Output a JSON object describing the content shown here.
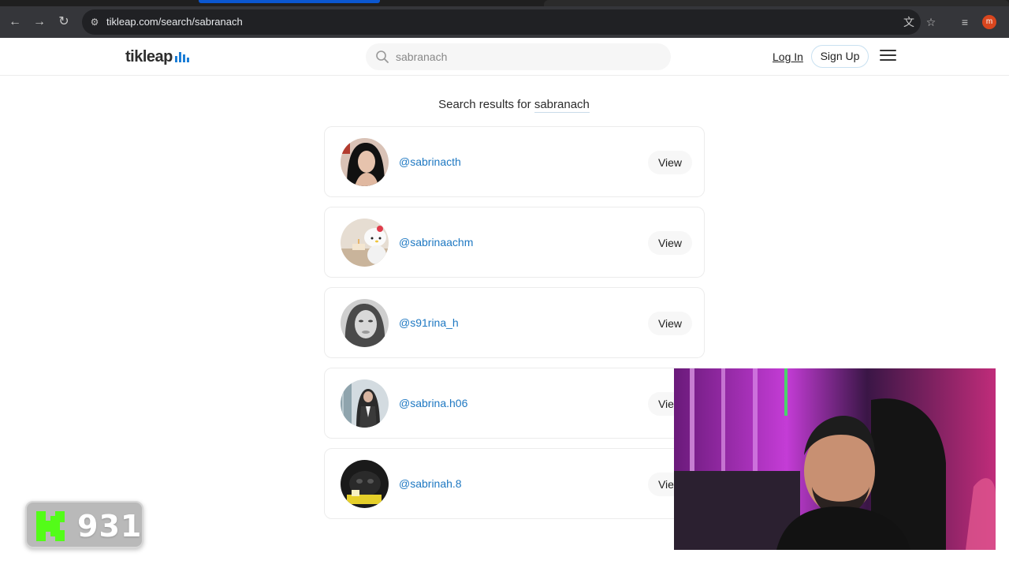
{
  "browser": {
    "url": "tikleap.com/search/sabranach",
    "profile_initial": "m"
  },
  "header": {
    "logo_text": "tikleap",
    "search_value": "sabranach",
    "login_label": "Log In",
    "signup_label": "Sign Up"
  },
  "results": {
    "title_prefix": "Search results for",
    "query": "sabranach",
    "items": [
      {
        "username": "@sabrinacth",
        "view_label": "View"
      },
      {
        "username": "@sabrinaachm",
        "view_label": "View"
      },
      {
        "username": "@s91rina_h",
        "view_label": "View"
      },
      {
        "username": "@sabrina.h06",
        "view_label": "View"
      },
      {
        "username": "@sabrinah.8",
        "view_label": "View"
      }
    ]
  },
  "overlay": {
    "kick_count": "931",
    "kick_color": "#53fc18"
  }
}
